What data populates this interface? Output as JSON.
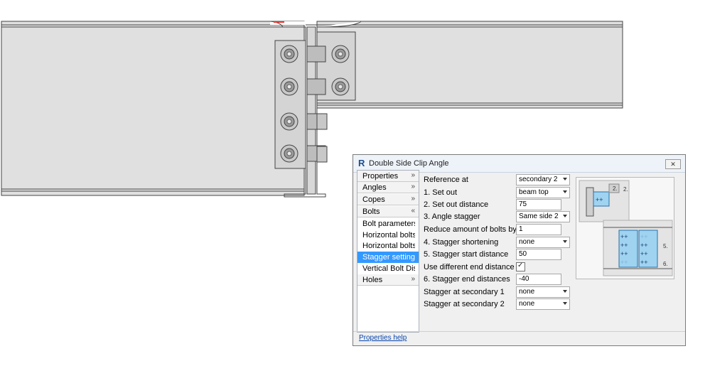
{
  "dialog": {
    "title": "Double Side Clip Angle",
    "logo": "R",
    "close_label": "✕",
    "help_link": "Properties help"
  },
  "nav": [
    {
      "label": "Properties",
      "chevron": "»"
    },
    {
      "label": "Angles",
      "chevron": "»"
    },
    {
      "label": "Copes",
      "chevron": "»"
    },
    {
      "label": "Bolts",
      "chevron": "«"
    },
    {
      "label": "Bolt parameters"
    },
    {
      "label": "Horizontal bolts m..."
    },
    {
      "label": "Horizontal bolts se..."
    },
    {
      "label": "Stagger settings",
      "selected": true
    },
    {
      "label": "Vertical Bolt Dista..."
    },
    {
      "label": "Holes",
      "chevron": "»"
    }
  ],
  "form": [
    {
      "label": "Reference at",
      "type": "select",
      "value": "secondary 2"
    },
    {
      "label": "1. Set out",
      "type": "select",
      "value": "beam top"
    },
    {
      "label": "2. Set out distance",
      "type": "text",
      "value": "75"
    },
    {
      "label": "3. Angle stagger",
      "type": "select",
      "value": "Same side 2"
    },
    {
      "label": "Reduce amount of bolts by",
      "type": "text",
      "value": "1"
    },
    {
      "label": "4. Stagger shortening",
      "type": "select",
      "value": "none"
    },
    {
      "label": "5. Stagger start distance",
      "type": "text",
      "value": "50"
    },
    {
      "label": "Use different end distance",
      "type": "checkbox",
      "value": "✓"
    },
    {
      "label": "6. Stagger end distances",
      "type": "text",
      "value": "-40"
    },
    {
      "label": "Stagger at secondary 1",
      "type": "select",
      "value": "none"
    },
    {
      "label": "Stagger at secondary 2",
      "type": "select",
      "value": "none"
    }
  ],
  "preview_labels": {
    "top": "2.",
    "mid": "5.",
    "bottom": "6."
  },
  "colors": {
    "selection": "#3399ff",
    "beam_fill": "#e0e0e0",
    "plate_fill": "#d4d4d4",
    "link": "#0645ad"
  }
}
